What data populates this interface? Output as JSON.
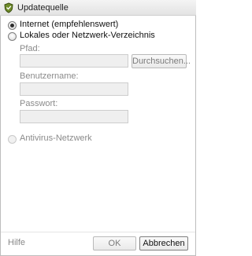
{
  "window": {
    "title": "Updatequelle",
    "icon": "shield-icon"
  },
  "options": {
    "internet_label": "Internet (empfehlenswert)",
    "local_label": "Lokales oder Netzwerk-Verzeichnis",
    "antivirus_label": "Antivirus-Netzwerk",
    "selected": "internet"
  },
  "fields": {
    "path_label": "Pfad:",
    "path_value": "",
    "browse_label": "Durchsuchen...",
    "username_label": "Benutzername:",
    "username_value": "",
    "password_label": "Passwort:",
    "password_value": ""
  },
  "footer": {
    "help_label": "Hilfe",
    "ok_label": "OK",
    "cancel_label": "Abbrechen"
  }
}
